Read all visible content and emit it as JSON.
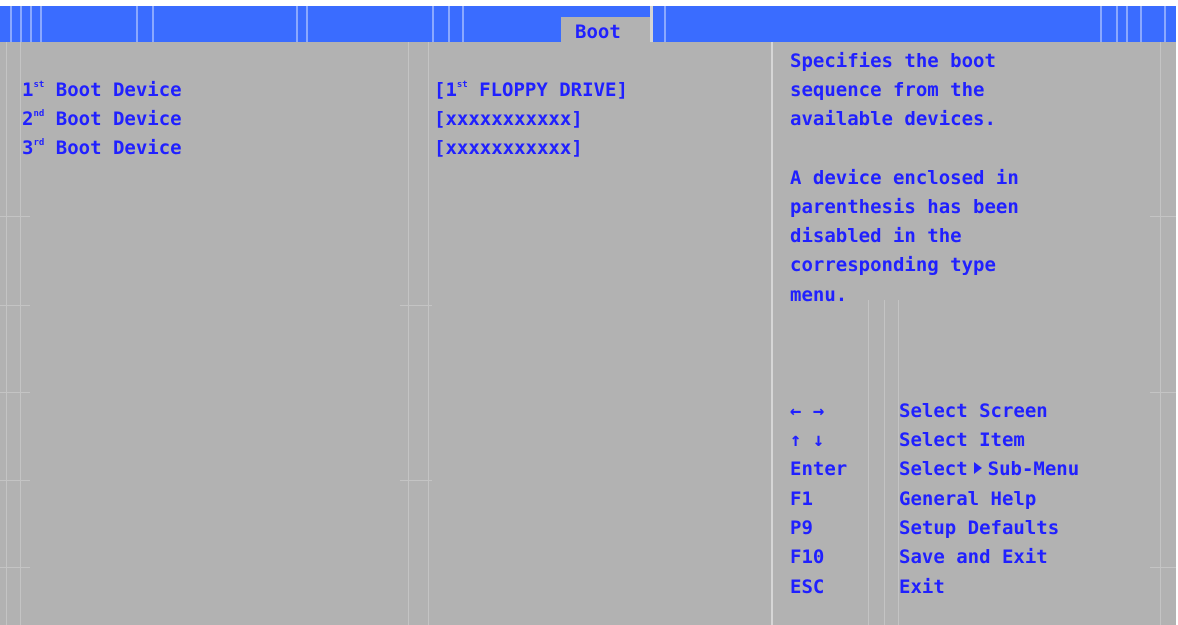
{
  "menubar": {
    "active_tab": "Boot"
  },
  "settings": [
    {
      "ordinal": "1",
      "suffix": "st",
      "label": "Boot Device",
      "value_prefix": "[1",
      "value_suffix": "st",
      "value_rest": " FLOPPY DRIVE]"
    },
    {
      "ordinal": "2",
      "suffix": "nd",
      "label": "Boot Device",
      "value_prefix": "[xxxxxxxxxxx]",
      "value_suffix": "",
      "value_rest": ""
    },
    {
      "ordinal": "3",
      "suffix": "rd",
      "label": "Boot Device",
      "value_prefix": "[xxxxxxxxxxx]",
      "value_suffix": "",
      "value_rest": ""
    }
  ],
  "help": {
    "lines": [
      "Specifies the boot",
      "sequence from the",
      "available devices.",
      "",
      "A device enclosed in",
      "parenthesis has been",
      "disabled in the",
      "corresponding type",
      "menu."
    ]
  },
  "keys": [
    {
      "key": "← →",
      "desc": "Select Screen"
    },
    {
      "key": "↑ ↓",
      "desc": "Select Item"
    },
    {
      "key": "Enter",
      "desc_before": "Select",
      "desc_after": "Sub-Menu"
    },
    {
      "key": "F1",
      "desc": "General Help"
    },
    {
      "key": "P9",
      "desc": "Setup Defaults"
    },
    {
      "key": "F10",
      "desc": "Save and Exit"
    },
    {
      "key": "ESC",
      "desc": "Exit"
    }
  ],
  "colors": {
    "menubar_bg": "#3a6cff",
    "panel_bg": "#b2b2b2",
    "text": "#2020ff"
  }
}
